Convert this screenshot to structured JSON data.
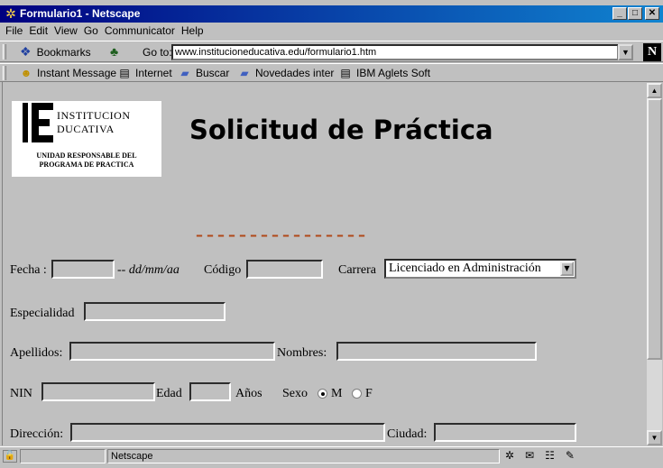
{
  "window": {
    "title": "Formulario1 - Netscape",
    "min": "_",
    "max": "□",
    "close": "✕"
  },
  "menu": [
    "File",
    "Edit",
    "View",
    "Go",
    "Communicator",
    "Help"
  ],
  "location": {
    "bookmarks_label": "Bookmarks",
    "goto_label": "Go to:",
    "url": "www.institucioneducativa.edu/formulario1.htm"
  },
  "personal_toolbar": [
    "Instant Message",
    "Internet",
    "Buscar",
    "Novedades inter",
    "IBM Aglets Soft"
  ],
  "page": {
    "logo": {
      "line1": "INSTITUCION",
      "line2": "DUCATIVA",
      "sub1": "UNIDAD RESPONSABLE DEL",
      "sub2": "PROGRAMA DE PRACTICA"
    },
    "title": "Solicitud de Práctica",
    "dashes": "––––––––––––––––",
    "form": {
      "fecha_label": "Fecha :",
      "fecha_format": "-- dd/mm/aa",
      "codigo_label": "Código",
      "carrera_label": "Carrera",
      "carrera_value": "Licenciado en Administración",
      "especialidad_label": "Especialidad",
      "apellidos_label": "Apellidos:",
      "nombres_label": "Nombres:",
      "nin_label": "NIN",
      "edad_label": "Edad",
      "anos_label": "Años",
      "sexo_label": "Sexo",
      "sexo_m": "M",
      "sexo_f": "F",
      "sexo_selected": "M",
      "direccion_label": "Dirección:",
      "ciudad_label": "Ciudad:"
    }
  },
  "status": {
    "text": "Netscape"
  }
}
